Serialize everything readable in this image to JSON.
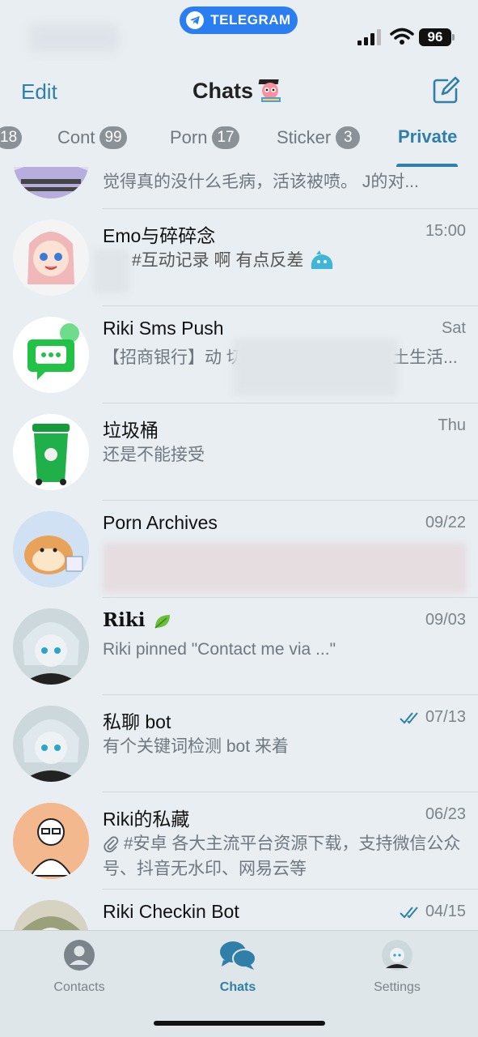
{
  "status_bar": {
    "pill_label": "TELEGRAM",
    "battery": "96"
  },
  "header": {
    "edit_label": "Edit",
    "title": "Chats"
  },
  "folder_tabs": [
    {
      "label": "",
      "badge": "18"
    },
    {
      "label": "Cont",
      "badge": "99"
    },
    {
      "label": "Porn",
      "badge": "17"
    },
    {
      "label": "Sticker",
      "badge": "3"
    },
    {
      "label": "Private",
      "badge": ""
    }
  ],
  "chats": [
    {
      "name": "",
      "time": "",
      "preview": "觉得真的没什么毛病，活该被喷。 J的对..."
    },
    {
      "name": "Emo与碎碎念",
      "time": "15:00",
      "preview": "#互动记录 啊 有点反差"
    },
    {
      "name": "Riki Sms Push",
      "time": "Sat",
      "preview": "【招商银行】动 切勿告知他人），您于 土生活..."
    },
    {
      "name": "垃圾桶",
      "time": "Thu",
      "preview": "还是不能接受"
    },
    {
      "name": "Porn Archives",
      "time": "09/22",
      "preview": ""
    },
    {
      "name": "Riki",
      "time": "09/03",
      "preview": "Riki pinned \"Contact me via ...\""
    },
    {
      "name": "私聊 bot",
      "time": "07/13",
      "preview": "有个关键词检测 bot 来着"
    },
    {
      "name": "Riki的私藏",
      "time": "06/23",
      "preview": "#安卓 各大主流平台资源下载，支持微信公众号、抖音无水印、网易云等"
    },
    {
      "name": "Riki Checkin Bot",
      "time": "04/15",
      "preview": ""
    }
  ],
  "tab_bar": {
    "contacts": "Contacts",
    "chats": "Chats",
    "settings": "Settings"
  },
  "colors": {
    "accent": "#2f7fa8",
    "telegram_blue": "#2a7ef0",
    "background": "#e8eef2"
  }
}
